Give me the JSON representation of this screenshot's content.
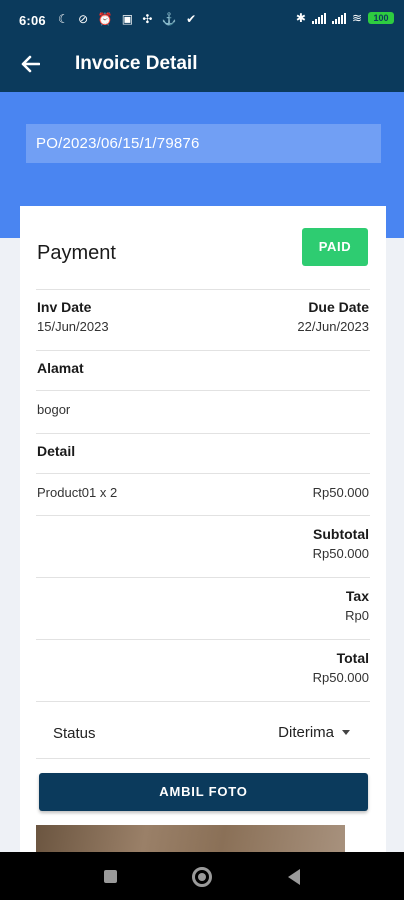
{
  "status_bar": {
    "time": "6:06",
    "left_icons": "☾ ⊘ ⏰ ▣ ✣ ⚓ ✔",
    "battery": "100"
  },
  "app_bar": {
    "title": "Invoice Detail"
  },
  "po_number": "PO/2023/06/15/1/79876",
  "payment": {
    "title": "Payment",
    "status_badge": "PAID",
    "inv_date_label": "Inv Date",
    "inv_date": "15/Jun/2023",
    "due_date_label": "Due Date",
    "due_date": "22/Jun/2023",
    "address_label": "Alamat",
    "address": "bogor",
    "detail_label": "Detail",
    "items": [
      {
        "name": "Product01 x 2",
        "price": "Rp50.000"
      }
    ],
    "subtotal_label": "Subtotal",
    "subtotal": "Rp50.000",
    "tax_label": "Tax",
    "tax": "Rp0",
    "total_label": "Total",
    "total": "Rp50.000",
    "status_label": "Status",
    "status_value": "Diterima",
    "photo_button": "AMBIL FOTO"
  },
  "colors": {
    "app_bar": "#0b3a5c",
    "band": "#4a85f1",
    "paid": "#2ecc71"
  }
}
